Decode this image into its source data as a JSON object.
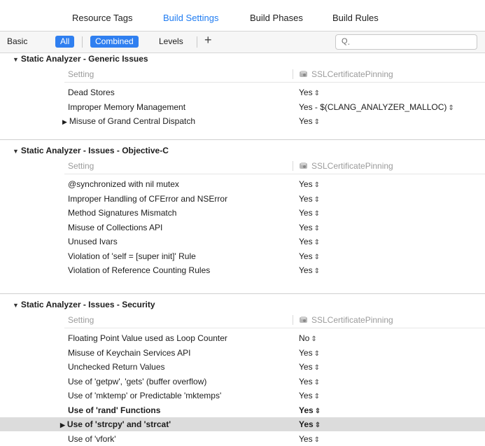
{
  "tabs": [
    "Resource Tags",
    "Build Settings",
    "Build Phases",
    "Build Rules"
  ],
  "active_tab": "Build Settings",
  "filters": {
    "basic": "Basic",
    "all": "All",
    "combined": "Combined",
    "levels": "Levels",
    "add": "+",
    "search_placeholder": "Q˯"
  },
  "column_setting": "Setting",
  "target_name": "SSLCertificatePinning",
  "sections": [
    {
      "title": "Static Analyzer - Generic Issues",
      "rows": [
        {
          "name": "Dead Stores",
          "value": "Yes"
        },
        {
          "name": "Improper Memory Management",
          "value": "Yes  -  $(CLANG_ANALYZER_MALLOC)"
        },
        {
          "name": "Misuse of Grand Central Dispatch",
          "value": "Yes"
        }
      ]
    },
    {
      "title": "Static Analyzer - Issues - Objective-C",
      "rows": [
        {
          "name": "@synchronized with nil mutex",
          "value": "Yes"
        },
        {
          "name": "Improper Handling of CFError and NSError",
          "value": "Yes"
        },
        {
          "name": "Method Signatures Mismatch",
          "value": "Yes"
        },
        {
          "name": "Misuse of Collections API",
          "value": "Yes"
        },
        {
          "name": "Unused Ivars",
          "value": "Yes"
        },
        {
          "name": "Violation of 'self = [super init]' Rule",
          "value": "Yes"
        },
        {
          "name": "Violation of Reference Counting Rules",
          "value": "Yes"
        }
      ]
    },
    {
      "title": "Static Analyzer - Issues - Security",
      "rows": [
        {
          "name": "Floating Point Value used as Loop Counter",
          "value": "No"
        },
        {
          "name": "Misuse of Keychain Services API",
          "value": "Yes"
        },
        {
          "name": "Unchecked Return Values",
          "value": "Yes"
        },
        {
          "name": "Use of 'getpw', 'gets' (buffer overflow)",
          "value": "Yes"
        },
        {
          "name": "Use of 'mktemp' or Predictable 'mktemps'",
          "value": "Yes"
        },
        {
          "name": "Use of 'rand' Functions",
          "value": "Yes"
        },
        {
          "name": "Use of 'strcpy' and 'strcat'",
          "value": "Yes"
        },
        {
          "name": "Use of 'vfork'",
          "value": "Yes"
        }
      ]
    }
  ],
  "colors": {
    "accent": "#2f7ff0",
    "selected_row": "#dcdcdc"
  }
}
